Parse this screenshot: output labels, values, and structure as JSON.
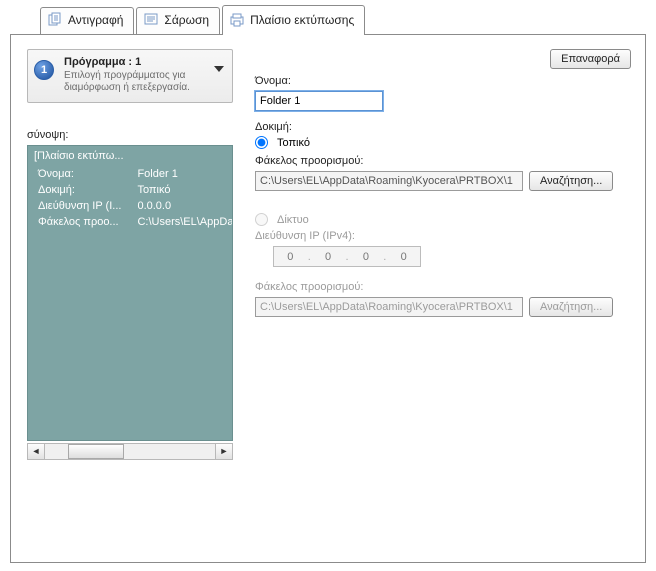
{
  "tabs": {
    "copy": "Αντιγραφή",
    "scan": "Σάρωση",
    "printbox": "Πλαίσιο εκτύπωσης"
  },
  "program": {
    "number": "1",
    "title": "Πρόγραμμα : 1",
    "subtitle": "Επιλογή προγράμματος για διαμόρφωση ή επεξεργασία."
  },
  "reset_label": "Επαναφορά",
  "summary": {
    "label": "σύνοψη:",
    "heading": "[Πλαίσιο εκτύπω...",
    "rows": [
      {
        "k": "Όνομα:",
        "v": "Folder 1"
      },
      {
        "k": "Δοκιμή:",
        "v": "Τοπικό"
      },
      {
        "k": "Διεύθυνση IP (I...",
        "v": "0.0.0.0"
      },
      {
        "k": "Φάκελος προο...",
        "v": "C:\\Users\\EL\\AppData"
      }
    ]
  },
  "form": {
    "name_label": "Όνομα:",
    "name_value": "Folder 1",
    "trial_label": "Δοκιμή:",
    "local_radio": "Τοπικό",
    "dest_label": "Φάκελος προορισμού:",
    "dest_value": "C:\\Users\\EL\\AppData\\Roaming\\Kyocera\\PRTBOX\\1",
    "browse": "Αναζήτηση...",
    "network_radio": "Δίκτυο",
    "ip_label": "Διεύθυνση IP (IPv4):",
    "ip": [
      "0",
      "0",
      "0",
      "0"
    ],
    "dest2_label": "Φάκελος προορισμού:",
    "dest2_value": "C:\\Users\\EL\\AppData\\Roaming\\Kyocera\\PRTBOX\\1",
    "browse2": "Αναζήτηση..."
  }
}
